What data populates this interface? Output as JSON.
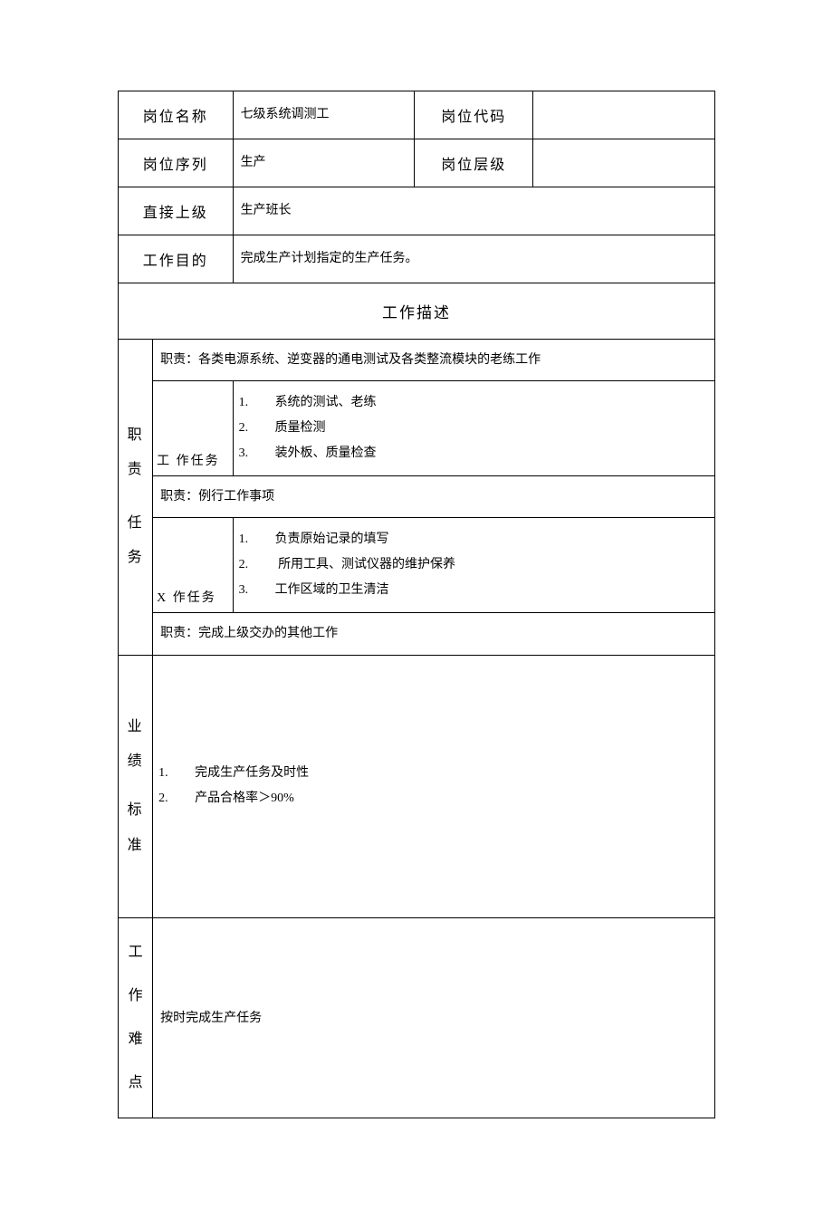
{
  "header": {
    "position_name_label": "岗位名称",
    "position_name_value": "七级系统调测工",
    "position_code_label": "岗位代码",
    "position_code_value": "",
    "position_sequence_label": "岗位序列",
    "position_sequence_value": "生产",
    "position_level_label": "岗位层级",
    "position_level_value": "",
    "direct_superior_label": "直接上级",
    "direct_superior_value": "生产班长",
    "work_purpose_label": "工作目的",
    "work_purpose_value": "完成生产计划指定的生产任务。"
  },
  "description_header": "工作描述",
  "duties": {
    "side_label_line1": "职责",
    "side_label_line2": "任务",
    "duty1_title": "职责：各类电源系统、逆变器的通电测试及各类整流模块的老练工作",
    "task_label1": "工 作任务",
    "duty1_tasks": [
      "系统的测试、老练",
      "质量检测",
      "装外板、质量检查"
    ],
    "duty2_title": "职责：例行工作事项",
    "task_label2": "X 作任务",
    "duty2_tasks": [
      "负责原始记录的填写",
      " 所用工具、测试仪器的维护保养",
      "工作区域的卫生清洁"
    ],
    "duty3_title": "职责：完成上级交办的其他工作"
  },
  "performance": {
    "side_label_line1": "业绩",
    "side_label_line2": "标准",
    "items": [
      "完成生产任务及时性",
      "产品合格率＞90%"
    ]
  },
  "difficulty": {
    "side_label_c1": "工",
    "side_label_c2": "作",
    "side_label_c3": "难",
    "side_label_c4": "点",
    "content": "按时完成生产任务"
  }
}
